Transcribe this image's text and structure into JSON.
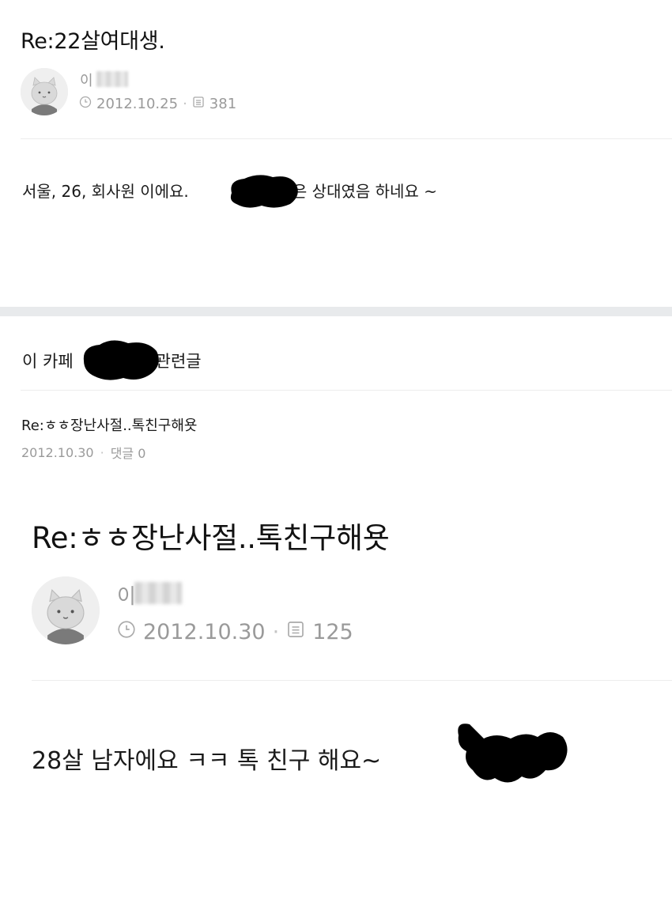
{
  "post1": {
    "title": "Re:22살여대생.",
    "author": "이",
    "date": "2012.10.25",
    "views": "381",
    "body_before": "서울, 26, 회사원 이에요. ",
    "body_after": " 좋은 상대였음 하네요 ~"
  },
  "related": {
    "heading_before": "이 카페",
    "heading_after": "관련글",
    "item": {
      "title": "Re:ㅎㅎ장난사절..톡친구해욧",
      "date": "2012.10.30",
      "comments": "댓글 0"
    }
  },
  "post2": {
    "title": "Re:ㅎㅎ장난사절..톡친구해욧",
    "author": "이",
    "date": "2012.10.30",
    "views": "125",
    "body": "28살 남자에요 ㅋㅋ 톡 친구 해요~"
  },
  "icons": {
    "clock": "clock-icon",
    "views": "document-icon",
    "avatar": "cat-avatar-icon"
  },
  "colors": {
    "text": "#1a1a1a",
    "meta": "#9a9a9a",
    "divider": "#ededed",
    "section_bar": "#e8eaec",
    "redaction": "#000000"
  }
}
